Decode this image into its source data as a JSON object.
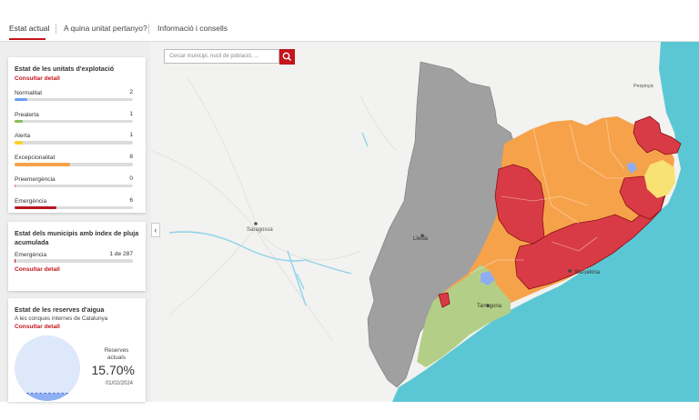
{
  "tabs": [
    {
      "label": "Estat actual"
    },
    {
      "label": "A quina unitat pertanyo?"
    },
    {
      "label": "Informació i consells"
    }
  ],
  "card1": {
    "title": "Estat de les unitats d'explotació",
    "link": "Consultar detall",
    "rows": [
      {
        "label": "Normalitat",
        "count": "2",
        "color": "#6d9dfb",
        "fraction": 0.11
      },
      {
        "label": "Prealerta",
        "count": "1",
        "color": "#8bbd5b",
        "fraction": 0.07
      },
      {
        "label": "Alerta",
        "count": "1",
        "color": "#f8d22a",
        "fraction": 0.07
      },
      {
        "label": "Excepcionalitat",
        "count": "8",
        "color": "#f6a24a",
        "fraction": 0.47
      },
      {
        "label": "Preemergència",
        "count": "0",
        "color": "#ef6f6f",
        "fraction": 0.01
      },
      {
        "label": "Emergència",
        "count": "6",
        "color": "#b81420",
        "fraction": 0.35
      }
    ]
  },
  "card2": {
    "title": "Estat dels municipis amb índex de pluja acumulada",
    "row_label": "Emergència",
    "row_count": "1 de 287",
    "row_color": "#b81420",
    "row_fraction": 0.004,
    "link": "Consultar detall"
  },
  "card3": {
    "title": "Estat de les reserves d'aigua",
    "subtitle": "A les conques internes de Catalunya",
    "link": "Consultar detall",
    "reserves_label": "Reserves actuals",
    "percent": "15.70%",
    "fraction": 0.157,
    "date": "01/02/2024"
  },
  "search": {
    "placeholder": "Cercar municipi, nucli de població, ..."
  },
  "map": {
    "labels": {
      "zaragoza": "Saragossa",
      "lleida": "Lleida",
      "tarragona": "Tarragona",
      "barcelona": "Barcelona",
      "perpinya": "Perpinyà"
    },
    "colors": {
      "sea": "#5bc7d4",
      "land": "#f2f2f0",
      "aragon": "#a0a0a0",
      "excepcionalitat": "#f6a24a",
      "emergencia": "#d83b45",
      "prealerta": "#b3cf87",
      "alerta": "#f8e274",
      "normalitat": "#8fadf0"
    }
  }
}
